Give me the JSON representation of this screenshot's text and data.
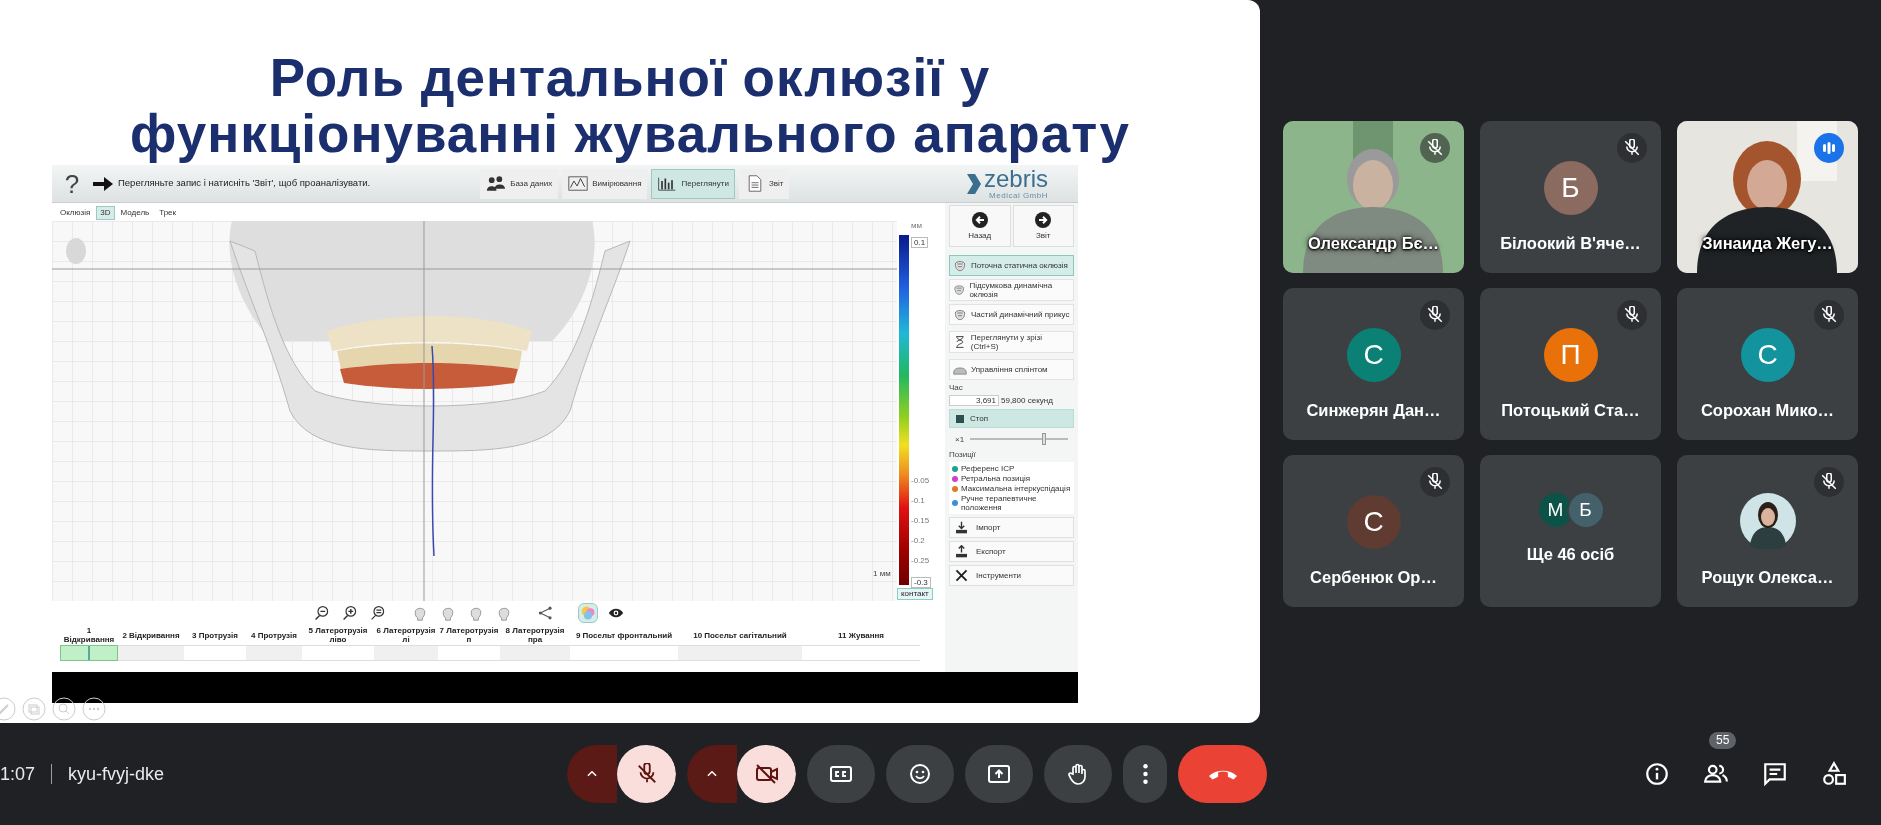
{
  "slide": {
    "title_lines": [
      "Роль дентальної оклюзії у",
      "функціонуванні жувального апарату"
    ],
    "app": {
      "help": "?",
      "hint": "Перегляньте запис і натисніть 'Звіт', щоб проаналізувати.",
      "toolbar": [
        {
          "label": "База даних",
          "selected": false
        },
        {
          "label": "Вимірювання",
          "selected": false
        },
        {
          "label": "Переглянути",
          "selected": true
        },
        {
          "label": "Звіт",
          "selected": false
        }
      ],
      "logo": {
        "name": "zebris",
        "sub": "Medical GmbH"
      },
      "view_tabs": [
        {
          "label": "Оклюзія",
          "selected": false
        },
        {
          "label": "3D",
          "selected": true
        },
        {
          "label": "Модель",
          "selected": false
        },
        {
          "label": "Трек",
          "selected": false
        }
      ],
      "scale": {
        "unit": "мм",
        "max": "0.1",
        "ticks": [
          "-0.05",
          "-0.1",
          "-0.15",
          "-0.2",
          "-0.25"
        ],
        "min": "-0.3",
        "contact": "контакт",
        "ruler": "1 мм"
      },
      "view_tools": [
        {
          "selected": false
        },
        {
          "selected": false
        },
        {
          "selected": false
        },
        {
          "selected": false
        },
        {
          "selected": false
        },
        {
          "selected": false
        },
        {
          "selected": false
        },
        {
          "selected": false
        },
        {
          "selected": true
        },
        {
          "selected": false
        }
      ],
      "timeline": [
        {
          "label": "1 Відкривання",
          "selected": true
        },
        {
          "label": "2 Відкривання",
          "selected": false
        },
        {
          "label": "3 Протрузія",
          "selected": false
        },
        {
          "label": "4 Протрузія",
          "selected": false
        },
        {
          "label": "5 Латеротрузія ліво",
          "selected": false
        },
        {
          "label": "6 Латеротрузія лі",
          "selected": false
        },
        {
          "label": "7 Латеротрузія п",
          "selected": false
        },
        {
          "label": "8 Латеротрузія пра",
          "selected": false
        },
        {
          "label": "9 Посельт фронтальний",
          "selected": false
        },
        {
          "label": "10 Посельт сагітальний",
          "selected": false
        },
        {
          "label": "11 Жування",
          "selected": false
        }
      ],
      "nav": [
        {
          "label": "Назад"
        },
        {
          "label": "Звіт"
        }
      ],
      "modes": [
        {
          "label": "Поточна статична оклюзія",
          "selected": true
        },
        {
          "label": "Підсумкова динамічна оклюзія",
          "selected": false
        },
        {
          "label": "Частий динамічний прикус",
          "selected": false
        },
        {
          "label": "Переглянути у зрізі (Ctrl+S)",
          "selected": false
        },
        {
          "label": "Управління сплінтом",
          "selected": false
        }
      ],
      "time": {
        "label": "Час",
        "value": "3,691",
        "total": "59,800 секунд"
      },
      "stop": {
        "label": "Стоп"
      },
      "speed": {
        "label": "×1",
        "level": 0.75
      },
      "positions": {
        "label": "Позиції",
        "items": [
          {
            "label": "Референс ICP",
            "color": "#1fa191"
          },
          {
            "label": "Ретральна позиція",
            "color": "#d03fcf"
          },
          {
            "label": "Максимальна інтеркуспідація",
            "color": "#e07a28"
          },
          {
            "label": "Ручне терапевтичне положення",
            "color": "#3b8fd8"
          }
        ]
      },
      "actions": [
        {
          "label": "Імпорт"
        },
        {
          "label": "Експорт"
        },
        {
          "label": "Інструменти"
        }
      ]
    }
  },
  "participants": [
    {
      "kind": "video",
      "name": "Олександр Бє…",
      "muted": true,
      "speaking": false
    },
    {
      "kind": "avatar",
      "name": "Білоокий В'яче…",
      "initial": "Б",
      "color": "#8b6a5f",
      "muted": true,
      "speaking": false
    },
    {
      "kind": "video",
      "name": "Зинаида Жегу…",
      "muted": false,
      "speaking": true
    },
    {
      "kind": "avatar",
      "name": "Синжерян Дан…",
      "initial": "С",
      "color": "#0b8175",
      "muted": true,
      "speaking": false
    },
    {
      "kind": "avatar",
      "name": "Потоцький Ста…",
      "initial": "П",
      "color": "#e8710a",
      "muted": true,
      "speaking": false
    },
    {
      "kind": "avatar",
      "name": "Сорохан Мико…",
      "initial": "С",
      "color": "#12939e",
      "muted": true,
      "speaking": false
    },
    {
      "kind": "avatar",
      "name": "Сербенюк Ор…",
      "initial": "С",
      "color": "#5f3b31",
      "muted": true,
      "speaking": false
    },
    {
      "kind": "others",
      "name": "Ще 46 осіб",
      "avatars": [
        {
          "initial": "М",
          "color": "#0d5246"
        },
        {
          "initial": "Б",
          "color": "#44606a"
        }
      ],
      "muted": false,
      "speaking": false
    },
    {
      "name": "Рощук Олекса…",
      "muted": true,
      "speaking": false
    }
  ],
  "meeting": {
    "time": "1:07",
    "code": "kyu-fvyj-dke"
  },
  "controls": [
    {
      "kind": "mic",
      "on": false
    },
    {
      "kind": "camera",
      "on": false
    },
    {
      "kind": "captions"
    },
    {
      "kind": "emoji"
    },
    {
      "kind": "present"
    },
    {
      "kind": "hand"
    },
    {
      "kind": "more"
    },
    {
      "kind": "leave"
    }
  ],
  "side_controls": [
    {
      "kind": "info"
    },
    {
      "kind": "people",
      "badge": "55"
    },
    {
      "kind": "chat"
    },
    {
      "kind": "activities"
    }
  ]
}
